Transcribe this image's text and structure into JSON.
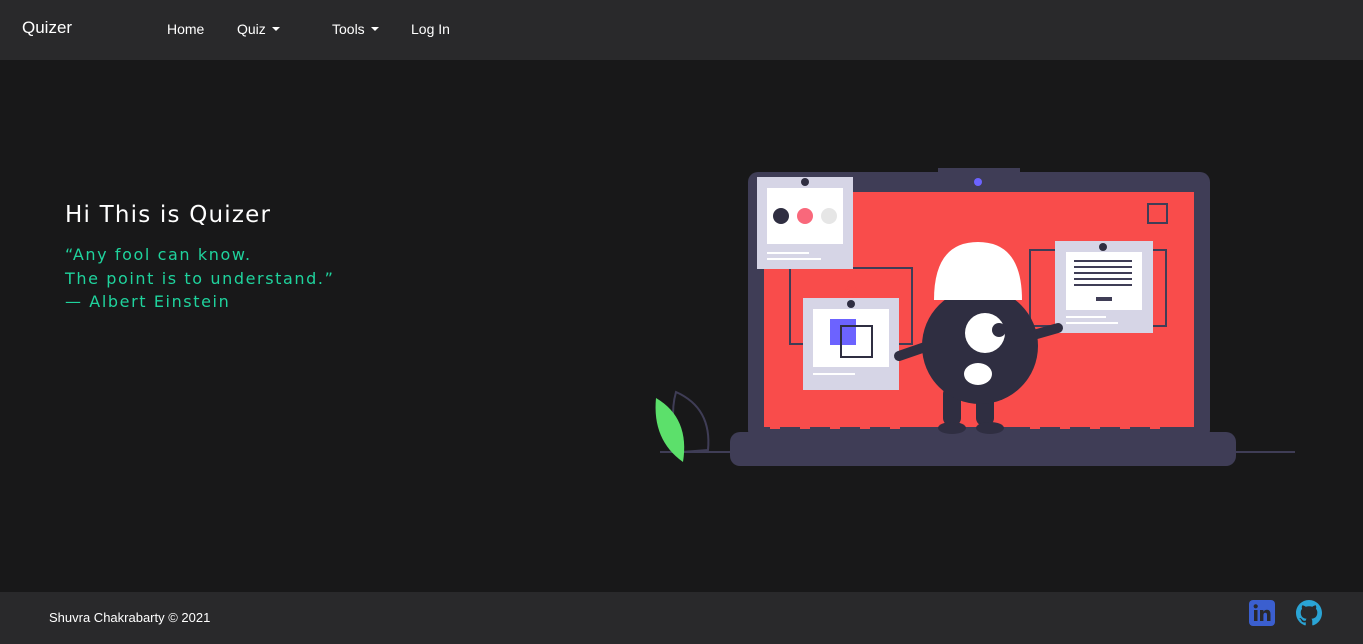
{
  "navbar": {
    "brand": "Quizer",
    "links": [
      {
        "label": "Home",
        "dropdown": false
      },
      {
        "label": "Quiz",
        "dropdown": true
      },
      {
        "label": "Tools",
        "dropdown": true
      },
      {
        "label": "Log In",
        "dropdown": false
      }
    ]
  },
  "hero": {
    "title": "Hi This is Quizer",
    "quote_lines": [
      "“Any fool can know.",
      "The point is to understand.”",
      "— Albert Einstein"
    ]
  },
  "footer": {
    "copyright": "Shuvra Chakrabarty © 2021",
    "social": [
      {
        "icon": "linkedin-icon",
        "color": "#3b5fcf"
      },
      {
        "icon": "github-icon",
        "color": "#2aa4d5"
      }
    ]
  },
  "colors": {
    "navbar_bg": "#29292b",
    "page_bg": "#181819",
    "quote": "#1fd39d",
    "screen": "#f94c4b",
    "laptop": "#3f3d56",
    "accent": "#6c63ff",
    "leaf": "#5ce06b"
  }
}
